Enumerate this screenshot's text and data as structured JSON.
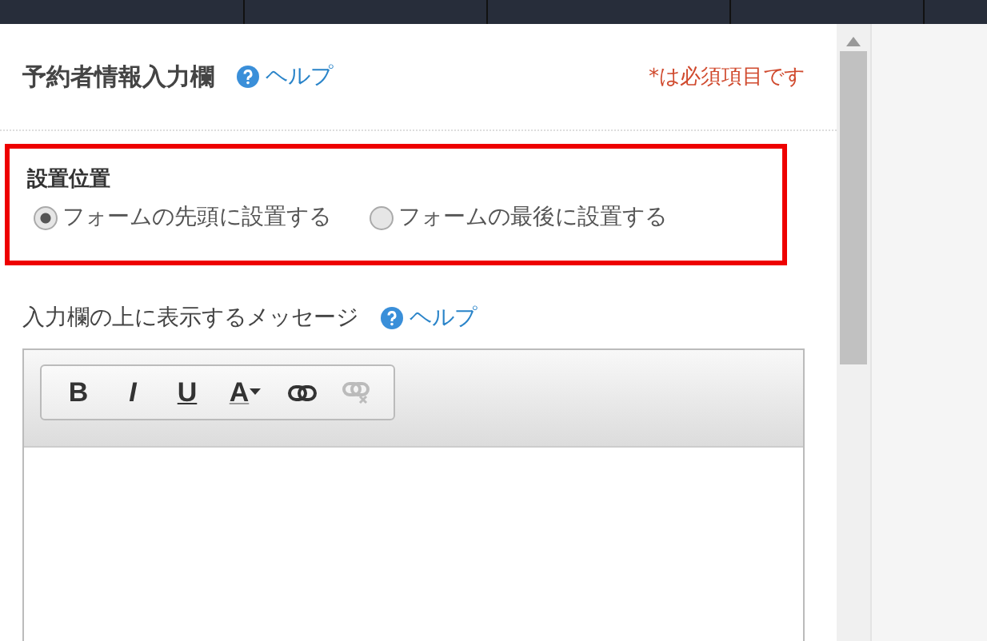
{
  "header": {
    "title": "予約者情報入力欄",
    "help": "ヘルプ",
    "required_note": "*は必須項目です"
  },
  "position": {
    "label": "設置位置",
    "options": [
      {
        "label": "フォームの先頭に設置する",
        "selected": true
      },
      {
        "label": "フォームの最後に設置する",
        "selected": false
      }
    ]
  },
  "message": {
    "label": "入力欄の上に表示するメッセージ",
    "help": "ヘルプ"
  },
  "toolbar": [
    {
      "kind": "bold",
      "text": "B",
      "disabled": false
    },
    {
      "kind": "italic",
      "text": "I",
      "disabled": false
    },
    {
      "kind": "underline",
      "text": "U",
      "disabled": false
    },
    {
      "kind": "color",
      "text": "A",
      "disabled": false
    },
    {
      "kind": "link",
      "disabled": false
    },
    {
      "kind": "unlink",
      "disabled": true
    }
  ]
}
